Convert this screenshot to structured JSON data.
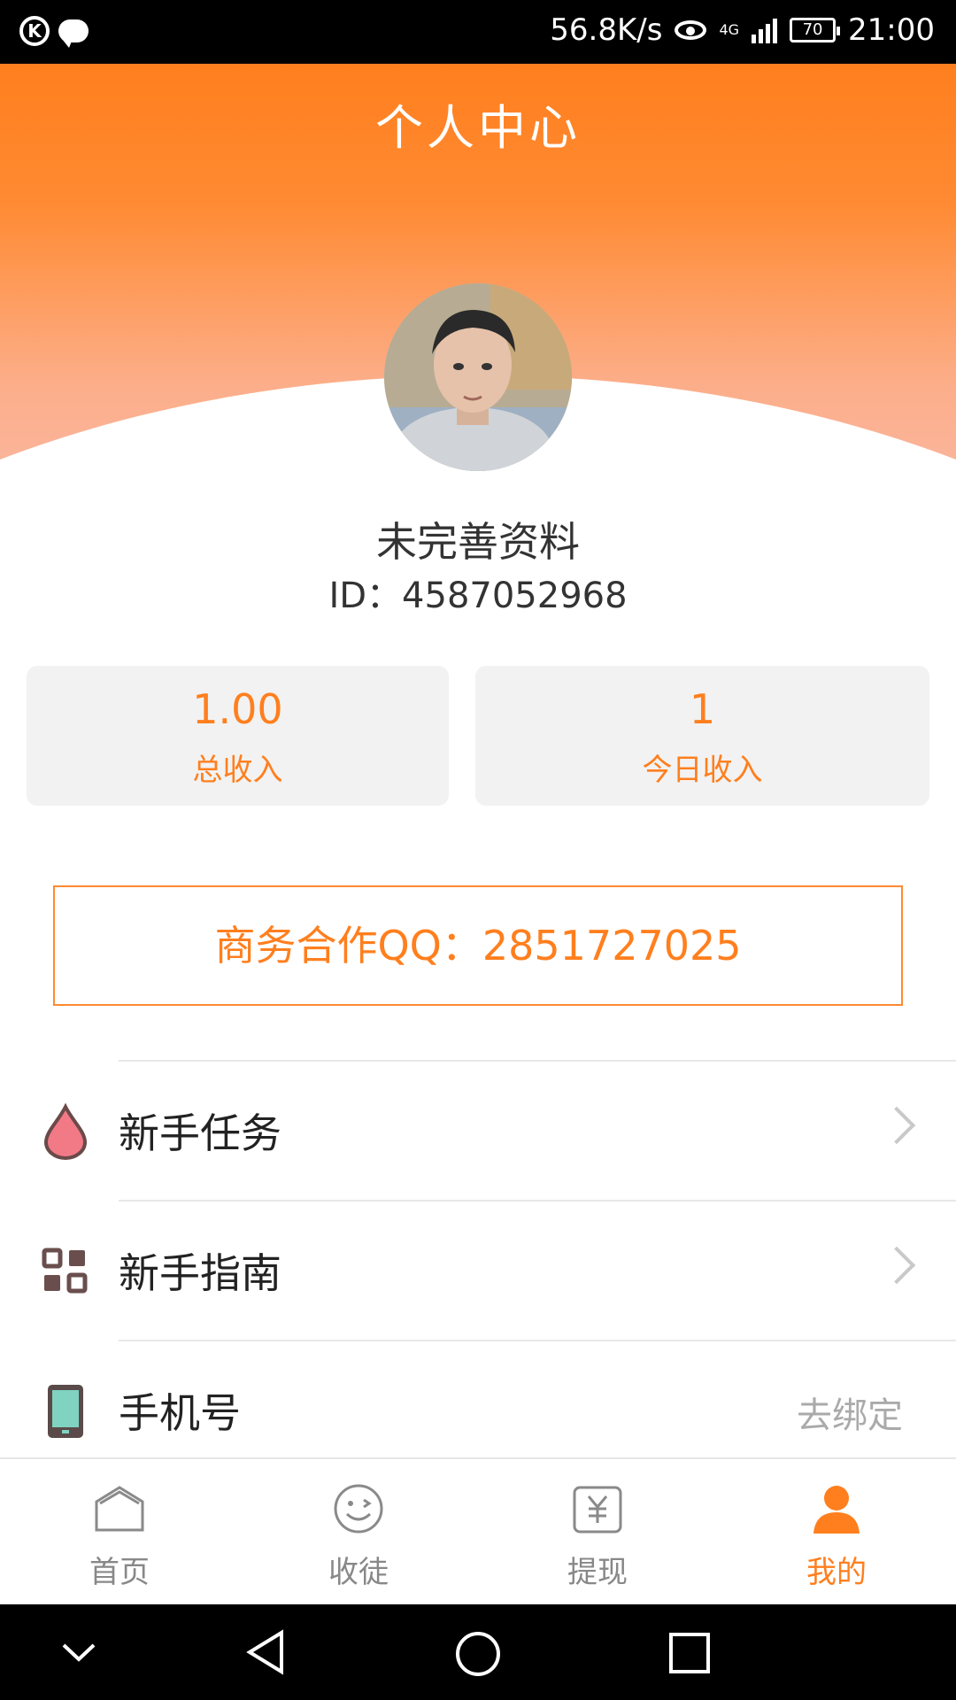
{
  "status_bar": {
    "speed": "56.8K/s",
    "network": "4G",
    "battery": "70",
    "time": "21:00"
  },
  "header": {
    "title": "个人中心"
  },
  "profile": {
    "name": "未完善资料",
    "id_text": "ID：4587052968"
  },
  "stats": [
    {
      "value": "1.00",
      "label": "总收入"
    },
    {
      "value": "1",
      "label": "今日收入"
    }
  ],
  "business": {
    "text": "商务合作QQ：2851727025"
  },
  "menu": [
    {
      "label": "新手任务",
      "icon": "drop-icon"
    },
    {
      "label": "新手指南",
      "icon": "grid-icon"
    },
    {
      "label": "手机号",
      "icon": "phone-icon",
      "value": "去绑定"
    }
  ],
  "bottom_nav": [
    {
      "label": "首页",
      "icon": "home-icon",
      "active": false
    },
    {
      "label": "收徒",
      "icon": "smile-icon",
      "active": false
    },
    {
      "label": "提现",
      "icon": "yuan-icon",
      "active": false
    },
    {
      "label": "我的",
      "icon": "person-icon",
      "active": true
    }
  ],
  "colors": {
    "accent": "#ff7f1e",
    "header_top": "#ff7f1e",
    "header_bottom": "#f9b9a6"
  }
}
